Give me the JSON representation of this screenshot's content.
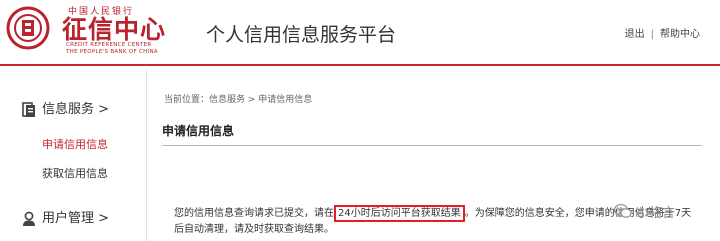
{
  "header": {
    "logo_top": "中国人民银行",
    "logo_main": "征信中心",
    "logo_en_line1": "CREDIT REFERENCE CENTER",
    "logo_en_line2": "THE PEOPLE'S BANK OF CHINA",
    "site_title": "个人信用信息服务平台",
    "links": {
      "logout": "退出",
      "separator": "|",
      "help": "帮助中心"
    }
  },
  "sidebar": {
    "groups": [
      {
        "label": "信息服务 >",
        "icon": "document-icon",
        "items": [
          {
            "label": "申请信用信息",
            "active": true
          },
          {
            "label": "获取信用信息",
            "active": false
          }
        ]
      },
      {
        "label": "用户管理 >",
        "icon": "user-icon",
        "items": []
      }
    ]
  },
  "main": {
    "breadcrumb": "当前位置：信息服务 > 申请信用信息",
    "title": "申请信用信息",
    "message": {
      "before": "您的信用信息查询请求已提交，请在",
      "highlight": "24小时后访问平台获取结果",
      "after": "。为保障您的信息安全，您申请的信用信息将于7天",
      "line2": "后自动清理，请及时获取查询结果。"
    }
  },
  "watermark": {
    "text": "小格言"
  },
  "colors": {
    "brand_red": "#c52730",
    "highlight_border": "#e51e25"
  }
}
